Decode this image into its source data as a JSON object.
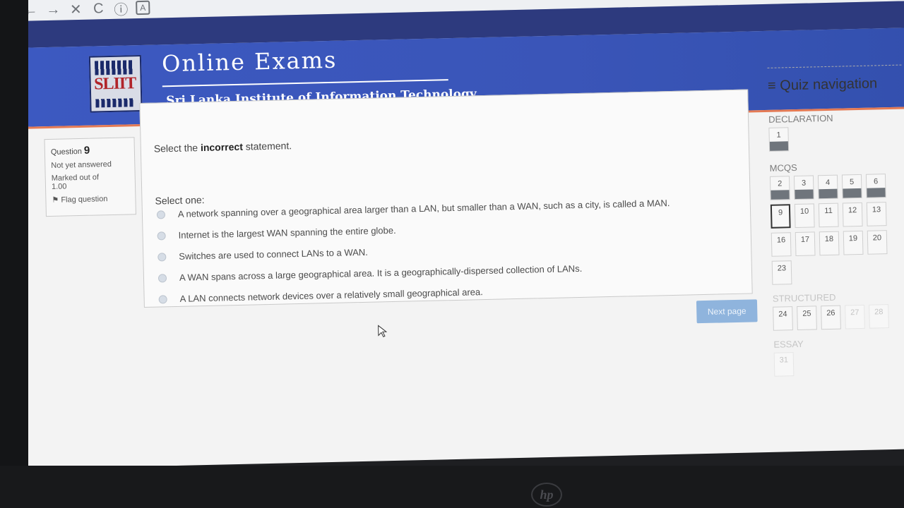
{
  "browser": {
    "back_icon": "←",
    "forward_icon": "→",
    "close_icon": "✕",
    "reload_icon": "C",
    "info_icon": "ⓘ",
    "translate_icon": "A"
  },
  "header": {
    "logo_text": "SLIIT",
    "title": "Online Exams",
    "subtitle": "Sri Lanka Institute of Information Technology"
  },
  "question_info": {
    "question_label": "Question",
    "question_number": "9",
    "status": "Not yet answered",
    "marked_label": "Marked out of",
    "marked_value": "1.00",
    "flag_label": "Flag question"
  },
  "question": {
    "prompt_before": "Select the ",
    "prompt_bold": "incorrect",
    "prompt_after": " statement.",
    "select_one": "Select one:",
    "answers": [
      "A network spanning over a geographical area larger than a LAN, but smaller than a WAN, such as a city, is called a MAN.",
      "Internet is the largest WAN spanning the entire globe.",
      "Switches are used to connect LANs to a WAN.",
      "A WAN spans across a large geographical area. It is a geographically-dispersed collection of LANs.",
      "A LAN connects network devices over a relatively small geographical area."
    ],
    "next_button": "Next page"
  },
  "quiz_nav": {
    "title": "Quiz navigation",
    "menu_icon": "≡",
    "sections": [
      {
        "name": "DECLARATION",
        "rows": [
          [
            "1"
          ]
        ]
      },
      {
        "name": "MCQS",
        "rows": [
          [
            "2",
            "3",
            "4",
            "5",
            "6"
          ],
          [
            "9",
            "10",
            "11",
            "12",
            "13"
          ],
          [
            "16",
            "17",
            "18",
            "19",
            "20"
          ],
          [
            "23"
          ]
        ]
      },
      {
        "name": "STRUCTURED",
        "rows": [
          [
            "24",
            "25",
            "26",
            "27",
            "28"
          ]
        ]
      },
      {
        "name": "ESSAY",
        "rows": [
          [
            "31"
          ]
        ]
      }
    ]
  },
  "device": {
    "brand": "hp"
  }
}
